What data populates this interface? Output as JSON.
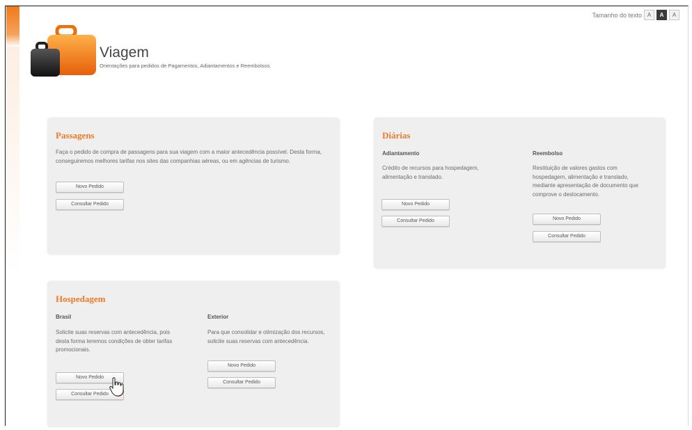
{
  "text_size": {
    "label": "Tamanho do texto",
    "options": [
      "A",
      "A",
      "A"
    ]
  },
  "header": {
    "title": "Viagem",
    "subtitle": "Orientações para pedidos de Pagamentos, Adiantamentos e Reembolsos."
  },
  "passagens": {
    "title": "Passagens",
    "description": "Faça o pedido de compra de passagens para sua viagem com a maior antecedência possível. Desta forma, conseguiremos melhores tarifas nos sites das companhias aéreas, ou em agências de turismo.",
    "new_label": "Novo Pedido",
    "check_label": "Consultar Pedido"
  },
  "diarias": {
    "title": "Diárias",
    "adiantamento": {
      "title": "Adiantamento",
      "description": "Crédito de recursos para hospedagem, alimentação e translado.",
      "new_label": "Novo Pedido",
      "check_label": "Consultar Pedido"
    },
    "reembolso": {
      "title": "Reembolso",
      "description": "Restituição de valores gastos com hospedagem, alimentação e translado, mediante apresentação de documento que comprove o deslocamento.",
      "new_label": "Novo Pedido",
      "check_label": "Consultar Pedido"
    }
  },
  "hospedagem": {
    "title": "Hospedagem",
    "brasil": {
      "title": "Brasil",
      "description": "Solicite suas reservas com antecedência, pois desta forma teremos condições de obter tarifas promocionais.",
      "new_label": "Novo Pedido",
      "check_label": "Consultar Pedido"
    },
    "exterior": {
      "title": "Exterior",
      "description": "Para que consolidar e otimização dos recursos, solicite suas reservas com antecedência.",
      "new_label": "Novo Pedido",
      "check_label": "Consultar Pedido"
    }
  },
  "colors": {
    "accent": "#ec7a26",
    "card_bg": "#efefef"
  },
  "icons": {
    "logo": "suitcase-icon",
    "cursor": "hand-pointer-icon"
  }
}
